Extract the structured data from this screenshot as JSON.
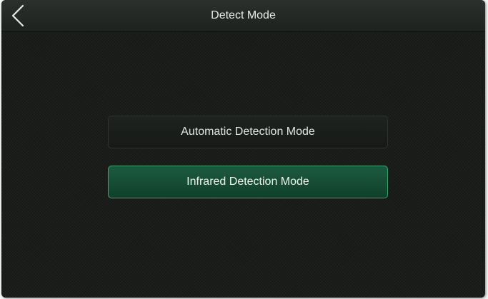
{
  "header": {
    "title": "Detect Mode",
    "back_icon": "chevron-left-icon"
  },
  "modes": [
    {
      "label": "Automatic Detection Mode",
      "selected": false
    },
    {
      "label": "Infrared Detection Mode",
      "selected": true
    }
  ],
  "colors": {
    "background": "#161916",
    "selected_button": "#1d5a40",
    "selected_border": "#3aa06e"
  }
}
